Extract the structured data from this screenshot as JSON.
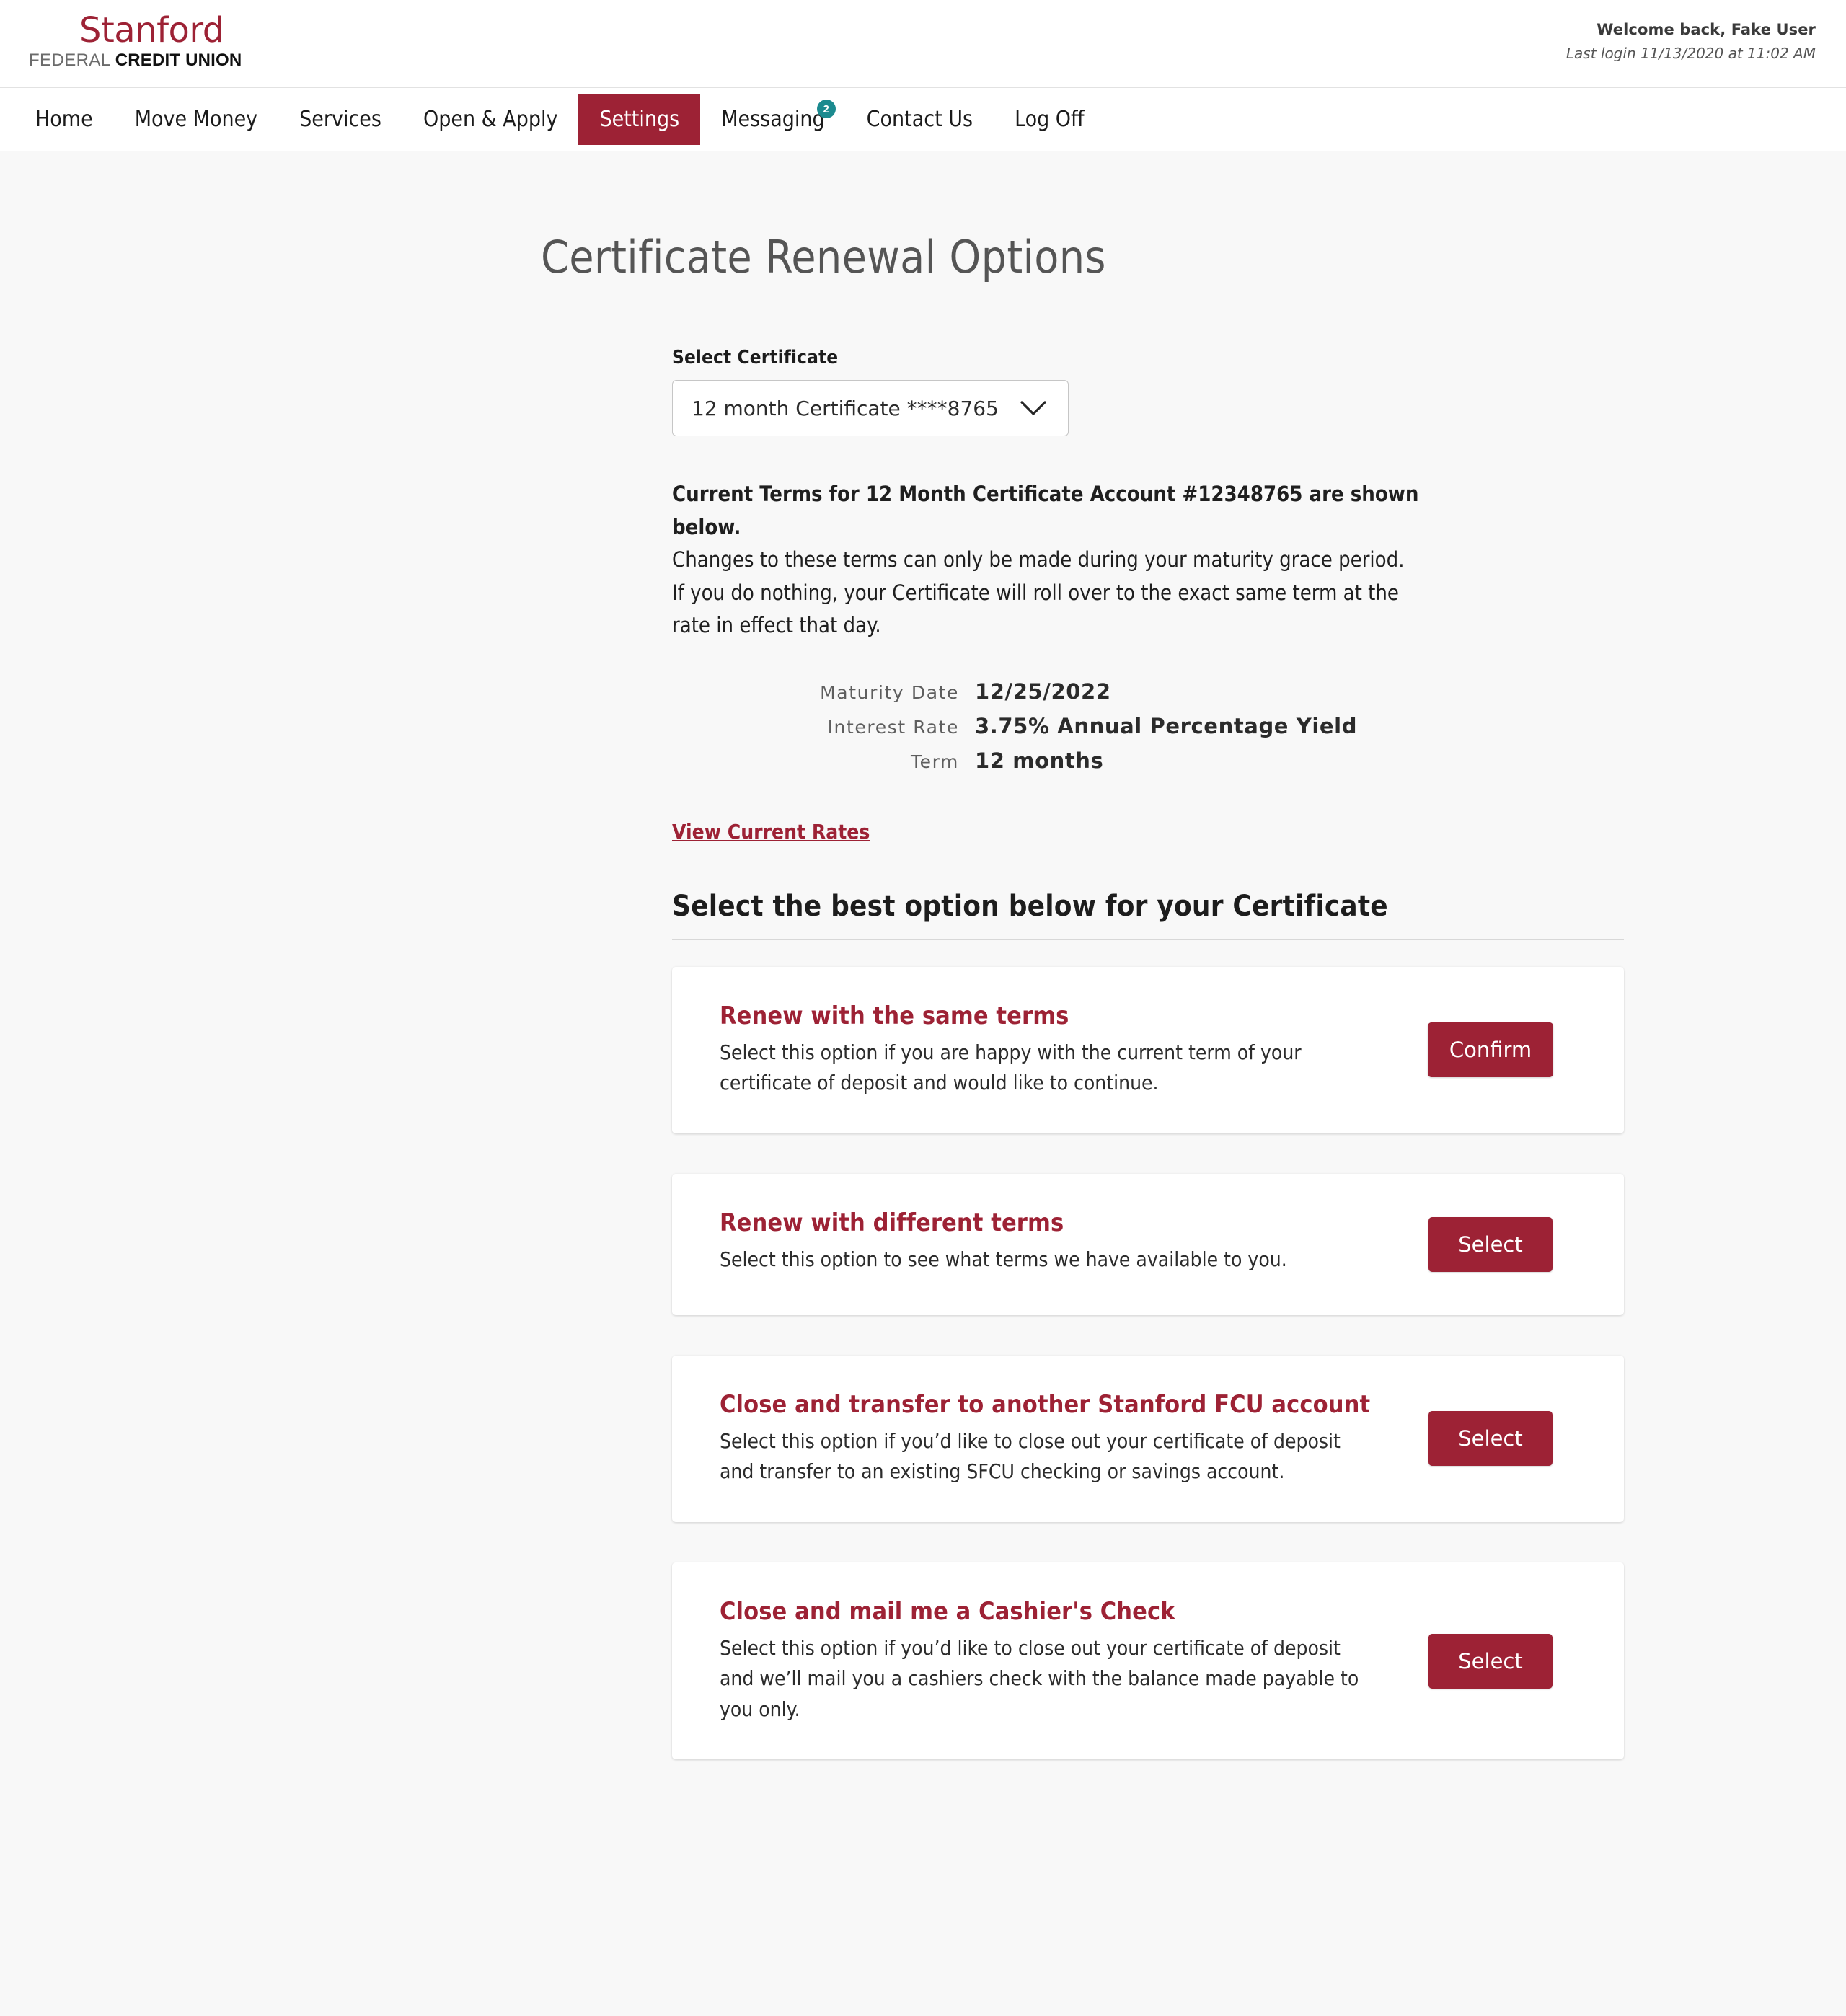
{
  "brand": {
    "logo_primary": "Stanford",
    "logo_secondary_light": "FEDERAL ",
    "logo_secondary_bold": "CREDIT UNION",
    "accent_color": "#9d2235",
    "badge_color": "#1b8a8f"
  },
  "header": {
    "welcome": "Welcome back, Fake User",
    "last_login": "Last login 11/13/2020 at 11:02 AM"
  },
  "nav": {
    "items": [
      {
        "label": "Home",
        "active": false,
        "badge": null
      },
      {
        "label": "Move Money",
        "active": false,
        "badge": null
      },
      {
        "label": "Services",
        "active": false,
        "badge": null
      },
      {
        "label": "Open & Apply",
        "active": false,
        "badge": null
      },
      {
        "label": "Settings",
        "active": true,
        "badge": null
      },
      {
        "label": "Messaging",
        "active": false,
        "badge": "2"
      },
      {
        "label": "Contact Us",
        "active": false,
        "badge": null
      },
      {
        "label": "Log Off",
        "active": false,
        "badge": null
      }
    ]
  },
  "page": {
    "title": "Certificate Renewal Options"
  },
  "certificate_select": {
    "label": "Select Certificate",
    "value": "12 month Certificate ****8765",
    "icon": "chevron-down-icon"
  },
  "terms": {
    "line_bold": "Current Terms for 12 Month Certificate Account #12348765 are shown below.",
    "line2": "Changes to these terms can only be made during your maturity grace period.",
    "line3": "If you do nothing, your Certificate will roll over to the exact same term at the",
    "line4": "rate in effect that day."
  },
  "details": [
    {
      "label": "Maturity Date",
      "value": "12/25/2022"
    },
    {
      "label": "Interest Rate",
      "value": "3.75% Annual Percentage Yield"
    },
    {
      "label": "Term",
      "value": "12 months"
    }
  ],
  "rates_link": "View Current Rates",
  "options_section": {
    "heading": "Select the best option below for your Certificate",
    "cards": [
      {
        "title": "Renew with the same terms",
        "desc": "Select this option if you are happy with the current term of your certificate of deposit and would like to continue.",
        "button": "Confirm"
      },
      {
        "title": "Renew with different terms",
        "desc": "Select this option to see what terms we have available to you.",
        "button": "Select"
      },
      {
        "title": "Close and transfer to another Stanford FCU account",
        "desc": "Select this option if you’d like to close out your certificate of deposit and transfer to an existing SFCU checking or savings account.",
        "button": "Select"
      },
      {
        "title": "Close and mail me a Cashier's Check",
        "desc": "Select this option if you’d like to close out your certificate of deposit and we’ll mail you a cashiers check with the balance made payable to you only.",
        "button": "Select"
      }
    ]
  }
}
